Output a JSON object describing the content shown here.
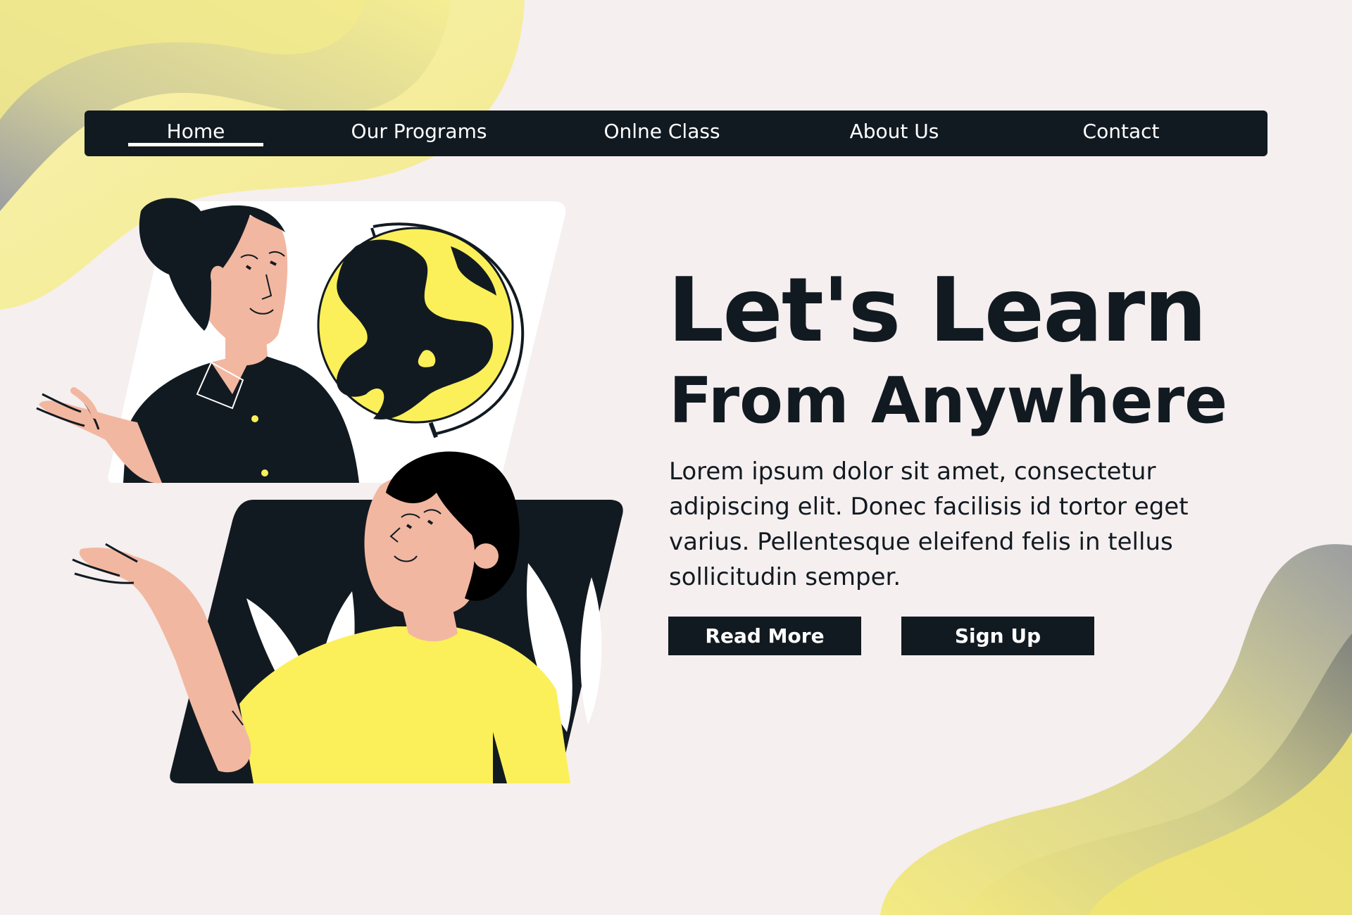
{
  "nav": {
    "items": [
      {
        "label": "Home",
        "active": true
      },
      {
        "label": "Our Programs"
      },
      {
        "label": "Onlne Class"
      },
      {
        "label": "About Us"
      },
      {
        "label": "Contact"
      }
    ]
  },
  "hero": {
    "title": "Let's Learn",
    "subtitle": "From Anywhere",
    "description": "Lorem ipsum dolor sit amet, consectetur adipiscing elit. Donec facilisis id tortor eget varius. Pellentesque eleifend felis in tellus sollicitudin semper.",
    "read_more_label": "Read More",
    "sign_up_label": "Sign Up"
  },
  "colors": {
    "background": "#f5efef",
    "dark": "#121a21",
    "accent_yellow": "#fbf05a",
    "skin": "#f2b7a0"
  }
}
